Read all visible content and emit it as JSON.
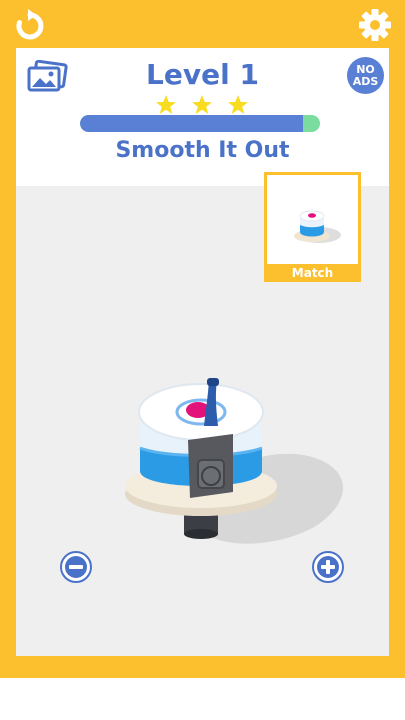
{
  "header": {
    "level_title": "Level 1",
    "subtitle": "Smooth It Out",
    "stars_earned": 3,
    "stars_total": 3,
    "progress": 0.93,
    "no_ads_line1": "NO",
    "no_ads_line2": "ADS"
  },
  "target": {
    "label": "Match"
  },
  "colors": {
    "frame": "#fcc02f",
    "accent": "#4b72c9",
    "progress_fill": "#5a80d6",
    "progress_track": "#7adc9f",
    "star": "#f7dc1f",
    "cake_blue": "#2b9be6",
    "cake_center": "#e3127b"
  },
  "icons": {
    "restart": "restart-icon",
    "settings": "gear-icon",
    "gallery": "gallery-icon",
    "zoom_out": "minus-circle-icon",
    "zoom_in": "plus-circle-icon"
  }
}
